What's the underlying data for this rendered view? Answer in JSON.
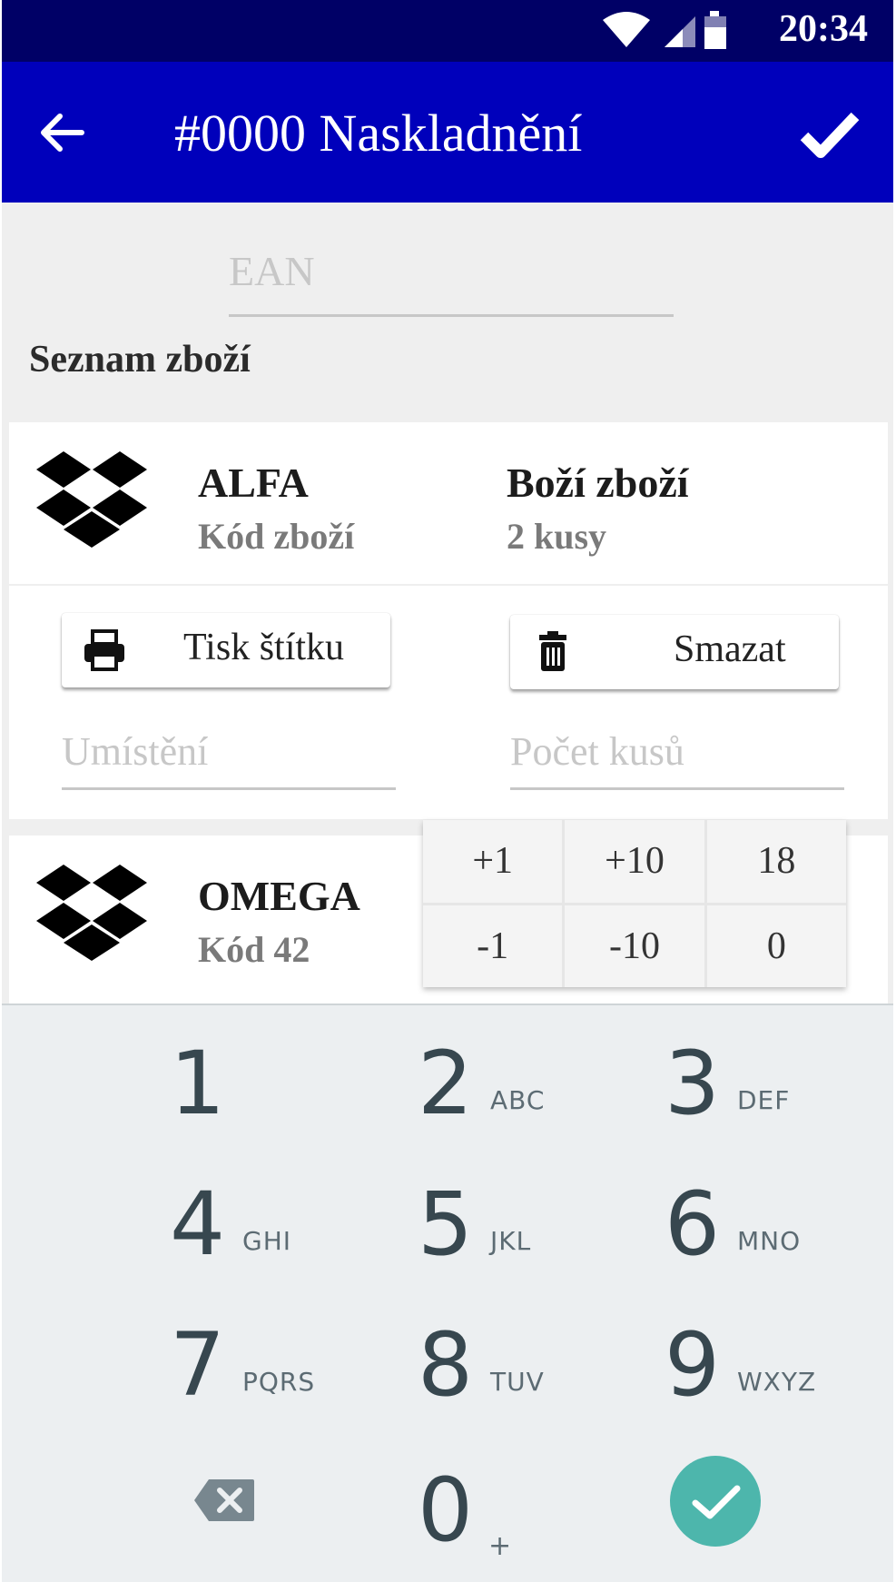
{
  "status_bar": {
    "time": "20:34"
  },
  "app_bar": {
    "title": "#0000 Naskladnění"
  },
  "ean": {
    "placeholder": "EAN"
  },
  "list": {
    "title": "Seznam zboží"
  },
  "items": [
    {
      "name": "ALFA",
      "code": "Kód zboží",
      "description": "Boží zboží",
      "quantity": "2 kusy",
      "print_label": "Tisk štítku",
      "delete_label": "Smazat",
      "location_placeholder": "Umístění",
      "count_placeholder": "Počet kusů"
    },
    {
      "name": "OMEGA",
      "code": "Kód 42"
    }
  ],
  "quick_adjust": [
    "+1",
    "+10",
    "18",
    "-1",
    "-10",
    "0"
  ],
  "keypad": {
    "keys": [
      {
        "digit": "1",
        "letters": ""
      },
      {
        "digit": "2",
        "letters": "ABC"
      },
      {
        "digit": "3",
        "letters": "DEF"
      },
      {
        "digit": "4",
        "letters": "GHI"
      },
      {
        "digit": "5",
        "letters": "JKL"
      },
      {
        "digit": "6",
        "letters": "MNO"
      },
      {
        "digit": "7",
        "letters": "PQRS"
      },
      {
        "digit": "8",
        "letters": "TUV"
      },
      {
        "digit": "9",
        "letters": "WXYZ"
      },
      {
        "digit": "0",
        "letters": "+"
      }
    ],
    "enter_color": "#4db6ac"
  },
  "colors": {
    "status_bar": "#000066",
    "app_bar": "#0000bb",
    "background": "#efefef"
  },
  "icons": [
    "wifi-icon",
    "signal-icon",
    "battery-icon",
    "back-arrow-icon",
    "check-icon",
    "dropbox-box-icon",
    "printer-icon",
    "trash-icon",
    "backspace-icon",
    "enter-check-icon"
  ]
}
